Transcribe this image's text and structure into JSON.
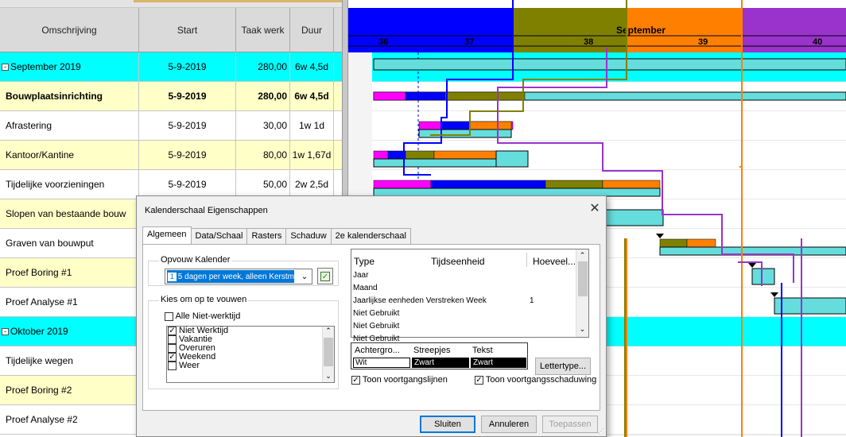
{
  "columns": [
    "Omschrijving",
    "Start",
    "Taak werk",
    "Duur"
  ],
  "rows": [
    {
      "name": "September 2019",
      "start": "5-9-2019",
      "work": "280,00",
      "dur": "6w 4,5d",
      "type": "group",
      "expand": "-"
    },
    {
      "name": "Bouwplaatsinrichting",
      "start": "5-9-2019",
      "work": "280,00",
      "dur": "6w 4,5d",
      "type": "yellow bold"
    },
    {
      "name": "Afrastering",
      "start": "5-9-2019",
      "work": "30,00",
      "dur": "1w 1d",
      "type": "white"
    },
    {
      "name": "Kantoor/Kantine",
      "start": "5-9-2019",
      "work": "80,00",
      "dur": "1w 1,67d",
      "type": "yellow"
    },
    {
      "name": "Tijdelijke voorzieningen",
      "start": "5-9-2019",
      "work": "50,00",
      "dur": "2w 2,5d",
      "type": "white"
    },
    {
      "name": "Slopen van bestaande bouw",
      "start": "",
      "work": "",
      "dur": "",
      "type": "yellow"
    },
    {
      "name": "Graven van bouwput",
      "start": "",
      "work": "",
      "dur": "",
      "type": "white"
    },
    {
      "name": "Proef Boring #1",
      "start": "",
      "work": "",
      "dur": "",
      "type": "yellow"
    },
    {
      "name": "Proef Analyse #1",
      "start": "",
      "work": "",
      "dur": "",
      "type": "white"
    },
    {
      "name": "Oktober 2019",
      "start": "",
      "work": "",
      "dur": "",
      "type": "group",
      "expand": "-"
    },
    {
      "name": "Tijdelijke wegen",
      "start": "",
      "work": "",
      "dur": "",
      "type": "white"
    },
    {
      "name": "Proef Boring #2",
      "start": "",
      "work": "",
      "dur": "",
      "type": "yellow"
    },
    {
      "name": "Proef Analyse #2",
      "start": "",
      "work": "",
      "dur": "",
      "type": "white"
    }
  ],
  "gantt": {
    "month_label": "September",
    "weeks": [
      "36",
      "37",
      "38",
      "39",
      "40"
    ],
    "colors": {
      "blue": "#0000ff",
      "olive": "#808000",
      "orange": "#ff8000",
      "purple": "#9933cc",
      "magenta": "#ff00ff",
      "cyan": "#66dddd"
    }
  },
  "dialog": {
    "title": "Kalenderschaal Eigenschappen",
    "close_glyph": "✕",
    "tabs": [
      "Algemeen",
      "Data/Schaal",
      "Rasters",
      "Schaduw",
      "2e kalenderschaal"
    ],
    "active_tab": "Algemeen",
    "fold_group_label": "Opvouw Kalender",
    "fold_value": "5 dagen per week, alleen Kerstm",
    "choose_group_label": "Kies om op te vouwen",
    "all_nonwork_label": "Alle Niet-werktijd",
    "fold_items": [
      {
        "label": "Niet Werktijd",
        "checked": true
      },
      {
        "label": "Vakantie",
        "checked": false
      },
      {
        "label": "Overuren",
        "checked": false
      },
      {
        "label": "Weekend",
        "checked": true
      },
      {
        "label": "Weer",
        "checked": false
      }
    ],
    "table_headers": [
      "Type",
      "Tijdseenheid",
      "Hoeveel..."
    ],
    "table_rows": [
      {
        "type": "Jaar",
        "unit": "",
        "qty": ""
      },
      {
        "type": "Maand",
        "unit": "",
        "qty": ""
      },
      {
        "type": "Jaarlijkse eenheden Verstreken Week",
        "unit": "",
        "qty": "1"
      },
      {
        "type": "Niet Gebruikt",
        "unit": "",
        "qty": ""
      },
      {
        "type": "Niet Gebruikt",
        "unit": "",
        "qty": ""
      },
      {
        "type": "Niet Gebruikt",
        "unit": "",
        "qty": ""
      }
    ],
    "color_headers": [
      "Achtergro...",
      "Streepjes",
      "Tekst"
    ],
    "color_values": [
      "Wit",
      "Zwart",
      "Zwart"
    ],
    "font_button": "Lettertype...",
    "show_progress_lines": "Toon voortgangslijnen",
    "show_progress_shading": "Toon voortgangsschaduwing",
    "close_button": "Sluiten",
    "cancel_button": "Annuleren",
    "apply_button": "Toepassen"
  }
}
